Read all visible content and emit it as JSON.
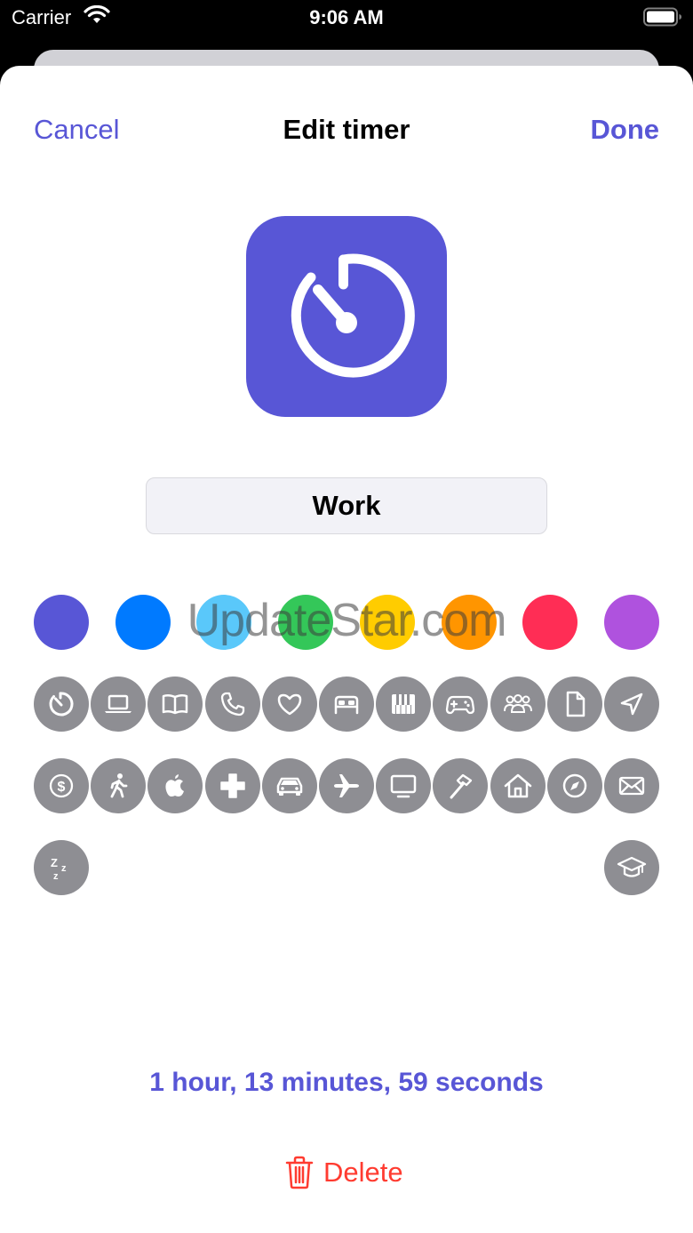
{
  "status_bar": {
    "carrier": "Carrier",
    "time": "9:06 AM"
  },
  "nav": {
    "cancel_label": "Cancel",
    "title": "Edit timer",
    "done_label": "Done"
  },
  "timer": {
    "icon": "timer-icon",
    "accent_color": "#5856d6",
    "name": "Work",
    "duration_text": "1 hour, 13 minutes, 59 seconds"
  },
  "colors": [
    "#5856d6",
    "#007aff",
    "#5ac8fa",
    "#34c759",
    "#ffcc00",
    "#ff9500",
    "#ff2d55",
    "#af52de"
  ],
  "icons": [
    "timer-icon",
    "laptop-icon",
    "book-icon",
    "phone-icon",
    "heart-icon",
    "bed-icon",
    "piano-icon",
    "gamecontroller-icon",
    "people-icon",
    "document-icon",
    "location-arrow-icon",
    "dollar-icon",
    "walking-icon",
    "apple-icon",
    "plus-icon",
    "car-icon",
    "airplane-icon",
    "tv-icon",
    "hammer-icon",
    "house-icon",
    "compass-icon",
    "envelope-icon",
    "sleep-icon",
    "graduation-cap-icon"
  ],
  "watermark": "UpdateStar.com",
  "delete_label": "Delete",
  "delete_color": "#ff3b30"
}
